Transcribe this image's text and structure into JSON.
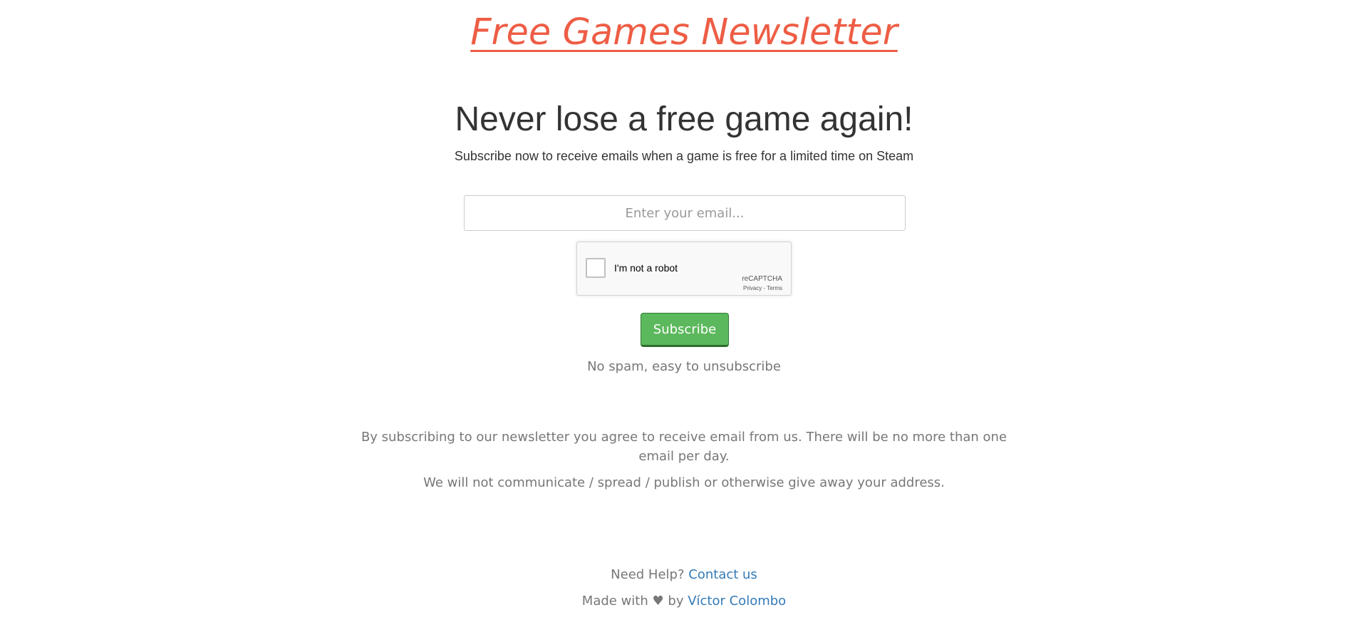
{
  "header": {
    "site_title": "Free Games Newsletter",
    "accent_color": "#ee5d45"
  },
  "hero": {
    "headline": "Never lose a free game again!",
    "subline": "Subscribe now to receive emails when a game is free for a limited time on Steam"
  },
  "form": {
    "email_placeholder": "Enter your email...",
    "email_value": "",
    "recaptcha": {
      "label": "I'm not a robot",
      "brand": "reCAPTCHA",
      "privacy_link": "Privacy",
      "separator": " - ",
      "terms_link": "Terms",
      "icon": "recaptcha-checkbox-icon"
    },
    "subscribe_label": "Subscribe",
    "button_color": "#5cb85c",
    "no_spam_note": "No spam, easy to unsubscribe"
  },
  "legal": {
    "terms_text": "By subscribing to our newsletter you agree to receive email from us. There will be no more than one email per day.",
    "privacy_text": "We will not communicate / spread / publish or otherwise give away your address."
  },
  "footer": {
    "help_prefix": "Need Help?",
    "contact_link": "Contact us",
    "made_prefix": "Made with",
    "heart": "♥",
    "made_by": "by",
    "author_link": "Víctor Colombo",
    "link_color": "#337ab7"
  }
}
